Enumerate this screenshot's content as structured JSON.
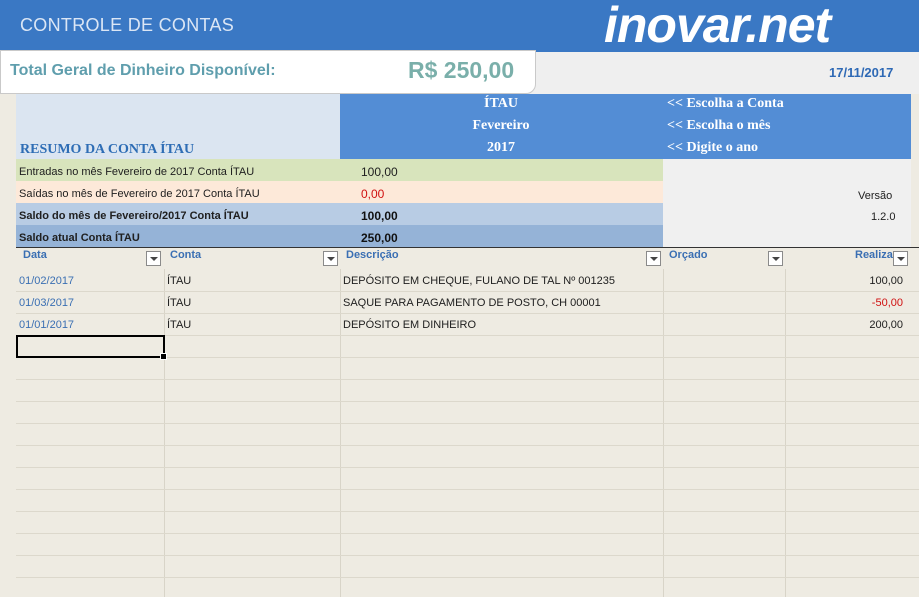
{
  "header": {
    "title": "CONTROLE DE CONTAS",
    "logo": "inovar.net"
  },
  "total": {
    "label": "Total Geral de Dinheiro Disponível:",
    "value": "R$ 250,00",
    "date": "17/11/2017"
  },
  "summary": {
    "title": "RESUMO DA CONTA ÍTAU",
    "selectors": [
      {
        "value": "ÍTAU",
        "hint": "<< Escolha a Conta"
      },
      {
        "value": "Fevereiro",
        "hint": "<< Escolha o mês"
      },
      {
        "value": "2017",
        "hint": "<< Digite o ano"
      }
    ],
    "rows": [
      {
        "label": "Entradas no mês Fevereiro de 2017 Conta ÍTAU",
        "value": "100,00"
      },
      {
        "label": "Saídas no mês de Fevereiro de 2017 Conta ÍTAU",
        "value": "0,00"
      },
      {
        "label": "Saldo do mês de Fevereiro/2017 Conta ÍTAU",
        "value": "100,00"
      },
      {
        "label": "Saldo atual Conta ÍTAU",
        "value": "250,00"
      }
    ],
    "version_label": "Versão",
    "version_value": "1.2.0"
  },
  "table": {
    "headers": [
      "Data",
      "Conta",
      "Descrição",
      "Orçado",
      "Realiza"
    ],
    "rows": [
      {
        "data": "01/02/2017",
        "conta": "ÍTAU",
        "descricao": "DEPÓSITO EM CHEQUE, FULANO DE TAL Nº 001235",
        "orcado": "",
        "realizado": "100,00"
      },
      {
        "data": "01/03/2017",
        "conta": "ÍTAU",
        "descricao": "SAQUE PARA PAGAMENTO DE POSTO, CH 00001",
        "orcado": "",
        "realizado": "-50,00"
      },
      {
        "data": "01/01/2017",
        "conta": "ÍTAU",
        "descricao": "DEPÓSITO EM DINHEIRO",
        "orcado": "",
        "realizado": "200,00"
      }
    ]
  },
  "colors": {
    "header_bg": "#3a78c4",
    "summary_blue": "#538dd5",
    "entradas_bg": "#d8e4bc",
    "saidas_bg": "#fde9d9",
    "saldo_mes_bg": "#b8cce4",
    "saldo_atual_bg": "#95b3d7",
    "negative": "#d01010"
  }
}
